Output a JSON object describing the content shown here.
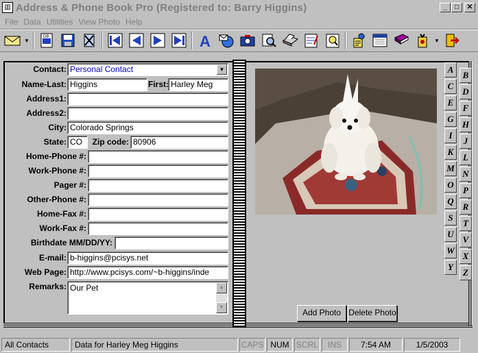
{
  "window": {
    "title": "Address & Phone Book Pro   (Registered to: Barry Higgins)"
  },
  "menu": [
    "File",
    "Data",
    "Utilities",
    "View Photo",
    "Help"
  ],
  "toolbar": {
    "icons": [
      "envelope-icon",
      "new-database-icon",
      "save-icon",
      "delete-icon",
      "first-record-icon",
      "prev-record-icon",
      "next-record-icon",
      "last-record-icon",
      "font-icon",
      "email-icon",
      "photo-icon",
      "find-icon",
      "print-icon",
      "notepad-icon",
      "preview-icon",
      "tools-icon",
      "calendar-icon",
      "book-icon",
      "reminder-icon",
      "exit-icon"
    ]
  },
  "form": {
    "contact_label": "Contact:",
    "contact_value": "Personal Contact",
    "name_last_label": "Name-Last:",
    "name_last": "Higgins",
    "first_label": "First:",
    "first": "Harley Meg",
    "address1_label": "Address1:",
    "address1": "",
    "address2_label": "Address2:",
    "address2": "",
    "city_label": "City:",
    "city": "Colorado Springs",
    "state_label": "State:",
    "state": "CO",
    "zip_label": "Zip code:",
    "zip": "80906",
    "home_phone_label": "Home-Phone #:",
    "home_phone": "",
    "work_phone_label": "Work-Phone #:",
    "work_phone": "",
    "pager_label": "Pager #:",
    "pager": "",
    "other_phone_label": "Other-Phone #:",
    "other_phone": "",
    "home_fax_label": "Home-Fax #:",
    "home_fax": "",
    "work_fax_label": "Work-Fax #:",
    "work_fax": "",
    "birthdate_label": "Birthdate MM/DD/YY:",
    "birthdate": "",
    "email_label": "E-mail:",
    "email": "b-higgins@pcisys.net",
    "webpage_label": "Web Page:",
    "webpage": "http://www.pcisys.com/~b-higgins/inde",
    "remarks_label": "Remarks:",
    "remarks": "Our Pet"
  },
  "photo_buttons": {
    "add": "Add Photo",
    "delete": "Delete Photo"
  },
  "tabs_left": [
    "A",
    "C",
    "E",
    "G",
    "I",
    "K",
    "M",
    "O",
    "Q",
    "S",
    "U",
    "W",
    "Y"
  ],
  "tabs_right": [
    "B",
    "D",
    "F",
    "H",
    "J",
    "L",
    "N",
    "P",
    "R",
    "T",
    "V",
    "X",
    "Z"
  ],
  "status": {
    "view": "All Contacts",
    "message": "Data for Harley Meg Higgins",
    "caps": "CAPS",
    "num": "NUM",
    "scrl": "SCRL",
    "ins": "INS",
    "time": "7:54 AM",
    "date": "1/5/2003"
  }
}
